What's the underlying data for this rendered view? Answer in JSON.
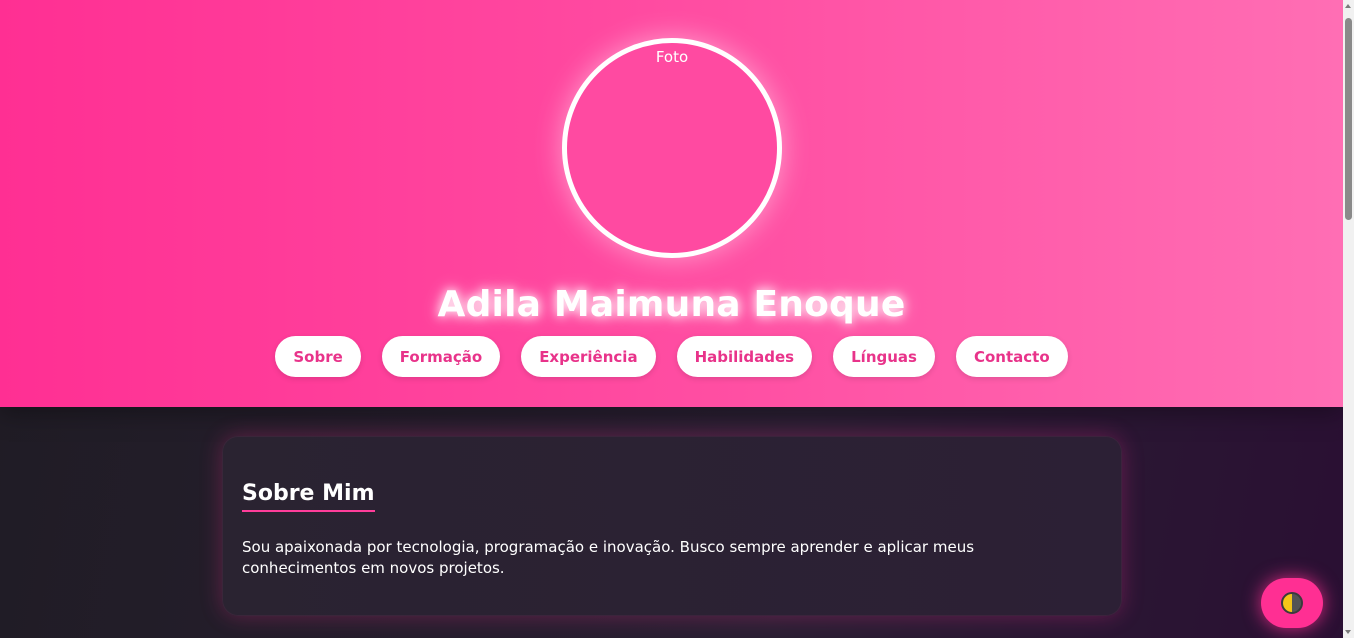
{
  "header": {
    "photo_label": "Foto",
    "name": "Adila Maimuna Enoque",
    "nav": [
      {
        "label": "Sobre"
      },
      {
        "label": "Formação"
      },
      {
        "label": "Experiência"
      },
      {
        "label": "Habilidades"
      },
      {
        "label": "Línguas"
      },
      {
        "label": "Contacto"
      }
    ]
  },
  "about": {
    "title": "Sobre Mim",
    "text": "Sou apaixonada por tecnologia, programação e inovação. Busco sempre aprender e aplicar meus conhecimentos em novos projetos."
  },
  "theme_toggle": {
    "icon": "half-moon-icon"
  },
  "colors": {
    "accent": "#ff2f93",
    "nav_text": "#e8338a",
    "card_bg": "#2a2331"
  }
}
